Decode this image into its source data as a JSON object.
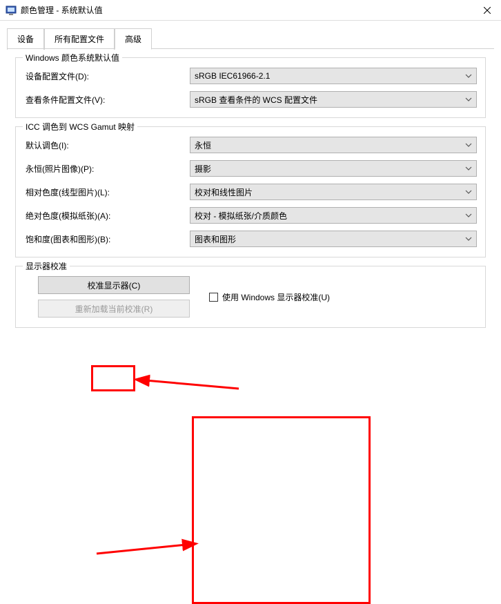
{
  "titlebar": {
    "title": "颜色管理 - 系统默认值"
  },
  "tabs": {
    "device": "设备",
    "allProfiles": "所有配置文件",
    "advanced": "高级"
  },
  "group1": {
    "legend": "Windows 颜色系统默认值",
    "deviceProfileLabel": "设备配置文件(D):",
    "deviceProfileValue": "sRGB IEC61966-2.1",
    "viewingCondLabel": "查看条件配置文件(V):",
    "viewingCondValue": "sRGB 查看条件的 WCS 配置文件"
  },
  "group2": {
    "legend": "ICC 调色到 WCS Gamut 映射",
    "defaultIntentLabel": "默认调色(I):",
    "defaultIntentValue": "永恒",
    "perceptualLabel": "永恒(照片图像)(P):",
    "perceptualValue": "摄影",
    "relColorLabel": "相对色度(线型图片)(L):",
    "relColorValue": "校对和线性图片",
    "absColorLabel": "绝对色度(模拟纸张)(A):",
    "absColorValue": "校对 - 模拟纸张/介质颜色",
    "saturationLabel": "饱和度(图表和图形)(B):",
    "saturationValue": "图表和图形"
  },
  "group3": {
    "legend": "显示器校准",
    "calibrateBtn": "校准显示器(C)",
    "reloadBtn": "重新加载当前校准(R)",
    "useWinCalib": "使用 Windows 显示器校准(U)"
  }
}
